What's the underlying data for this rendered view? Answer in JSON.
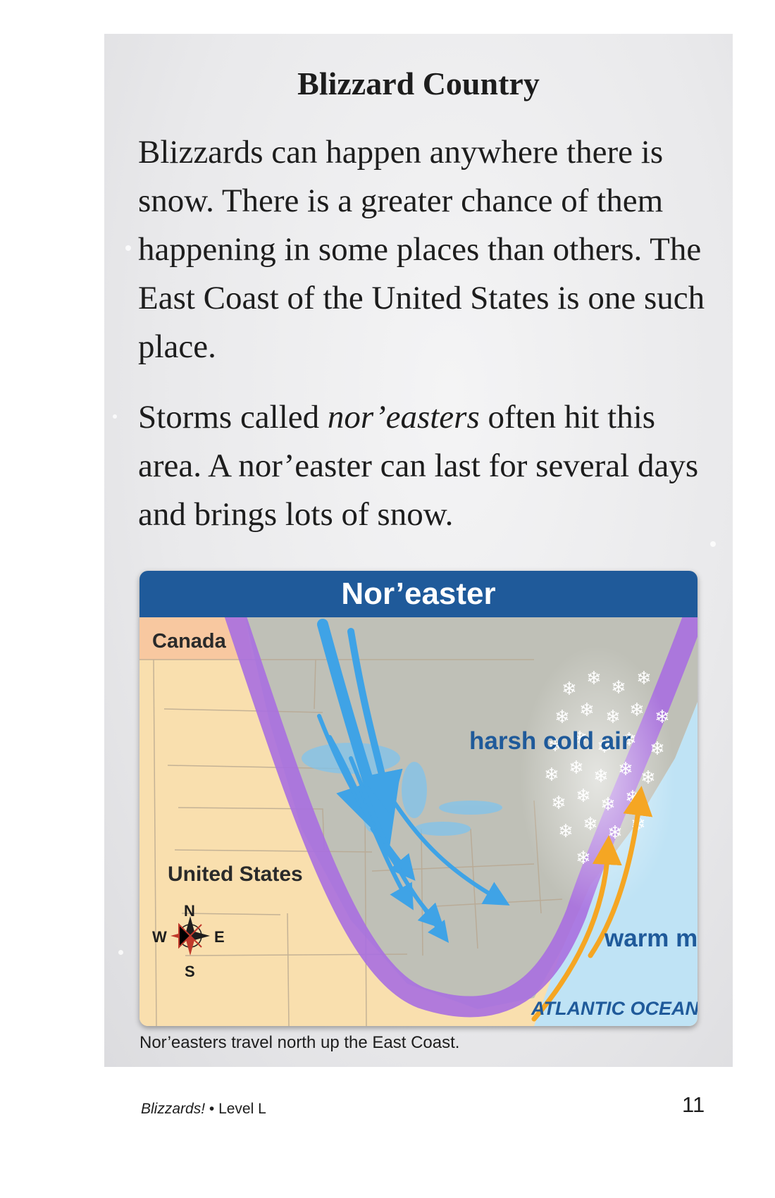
{
  "page": {
    "title": "Blizzard Country",
    "paragraph1": "Blizzards can happen anywhere there is snow. There is a greater chance of them happening in some places than others. The East Coast of the United States is one such place.",
    "paragraph2_pre": "Storms called ",
    "paragraph2_italic": "nor’easters",
    "paragraph2_post": " often hit this area. A nor’easter can last for several days and brings lots of snow."
  },
  "map": {
    "title": "Nor’easter",
    "labels": {
      "canada": "Canada",
      "united_states": "United States",
      "harsh_cold_air": "harsh cold air",
      "warm_moist_air": "warm moist air",
      "ocean": "ATLANTIC OCEAN"
    },
    "compass": {
      "n": "N",
      "s": "S",
      "e": "E",
      "w": "W"
    },
    "colors": {
      "header": "#1f5a9a",
      "land": "#f9dfae",
      "canada": "#f8c8a0",
      "ocean": "#bfe3f5",
      "storm_band": "#a86fe0",
      "cold_air_arrows": "#3fa3e6",
      "warm_air_arrows": "#f5a623"
    },
    "caption": "Nor’easters travel north up the East Coast."
  },
  "footer": {
    "book_title": "Blizzards!",
    "separator": " • ",
    "level": "Level L",
    "page_number": "11"
  }
}
